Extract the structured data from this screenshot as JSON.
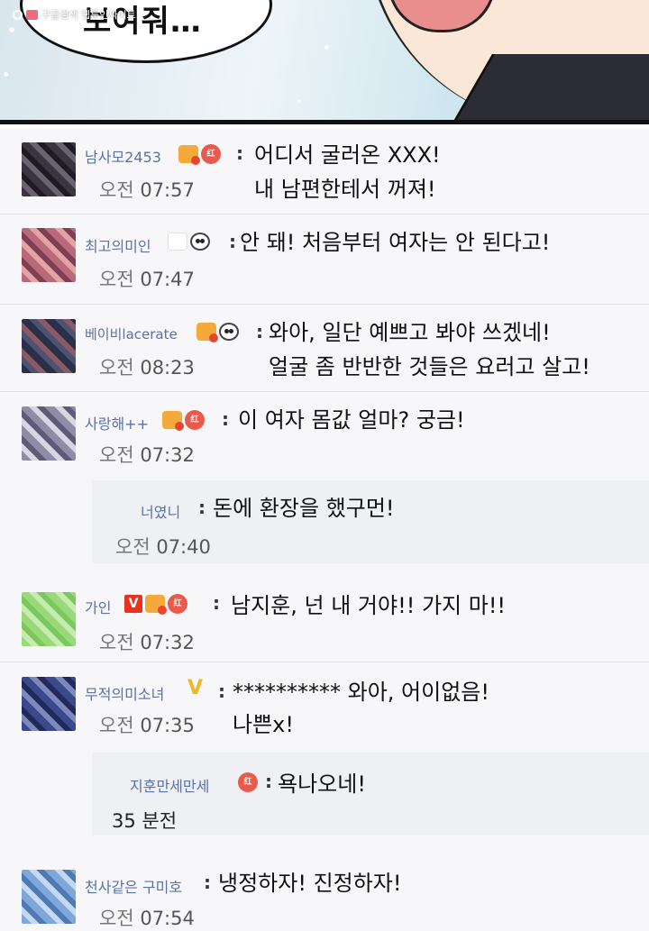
{
  "panel": {
    "bubble_text": "보여줘…",
    "watermark": "구글검색 웹툰인싸이트"
  },
  "comments": [
    {
      "name": "남사모2453",
      "time_prefix": "오전",
      "time": "07:57",
      "line1": "어디서 굴러온 XXX!",
      "line2": "내 남편한테서 꺼져!"
    },
    {
      "name": "최고의미인",
      "time_prefix": "오전",
      "time": "07:47",
      "line1": "안 돼! 처음부터 여자는 안 된다고!",
      "line2": ""
    },
    {
      "name": "베이비lacerate",
      "time_prefix": "오전",
      "time": "08:23",
      "line1": "와아, 일단 예쁘고 봐야 쓰겠네!",
      "line2": "얼굴 좀 반반한 것들은 요러고 살고!"
    },
    {
      "name": "사랑해++",
      "time_prefix": "오전",
      "time": "07:32",
      "line1": "이 여자 몸값 얼마? 궁금!",
      "line2": ""
    },
    {
      "name": "가인",
      "time_prefix": "오전",
      "time": "07:32",
      "line1": "남지훈, 넌 내 거야!! 가지 마!!",
      "line2": ""
    },
    {
      "name": "무적의미소녀",
      "time_prefix": "오전",
      "time": "07:35",
      "line1": "********** 와아, 어이없음!",
      "line2": "나쁜x!"
    },
    {
      "name": "천사같은 구미호",
      "time_prefix": "오전",
      "time": "07:54",
      "line1": "냉정하자! 진정하자!",
      "line2": ""
    }
  ],
  "replies": [
    {
      "name": "너였니",
      "time_prefix": "오전",
      "time": "07:40",
      "text": "돈에 환장을 했구먼!"
    },
    {
      "name": "지훈만세만세",
      "time": "35 분전",
      "text": "욕나오네!"
    }
  ],
  "badge_labels": {
    "red": "红",
    "v": "V",
    "crown_5": "5",
    "crown_6": "6"
  },
  "colon": ":"
}
